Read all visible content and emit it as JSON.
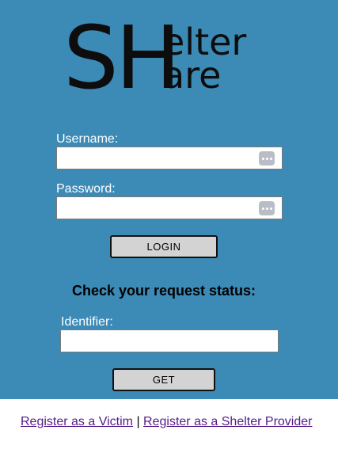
{
  "logo": {
    "initials": "SH",
    "line1": "elter",
    "line2": "are"
  },
  "login": {
    "username_label": "Username:",
    "username_value": "",
    "password_label": "Password:",
    "password_value": "",
    "login_button": "LOGIN"
  },
  "status": {
    "heading": "Check your request status:",
    "identifier_label": "Identifier:",
    "identifier_value": "",
    "get_button": "GET"
  },
  "footer": {
    "register_victim": "Register as a Victim",
    "separator": "|",
    "register_provider": "Register as a Shelter Provider"
  },
  "colors": {
    "panel_background": "#3c8ab6",
    "link": "#551a8b",
    "button_background": "#d3d3d3"
  },
  "icons": {
    "password_manager": "key-dots-icon"
  }
}
